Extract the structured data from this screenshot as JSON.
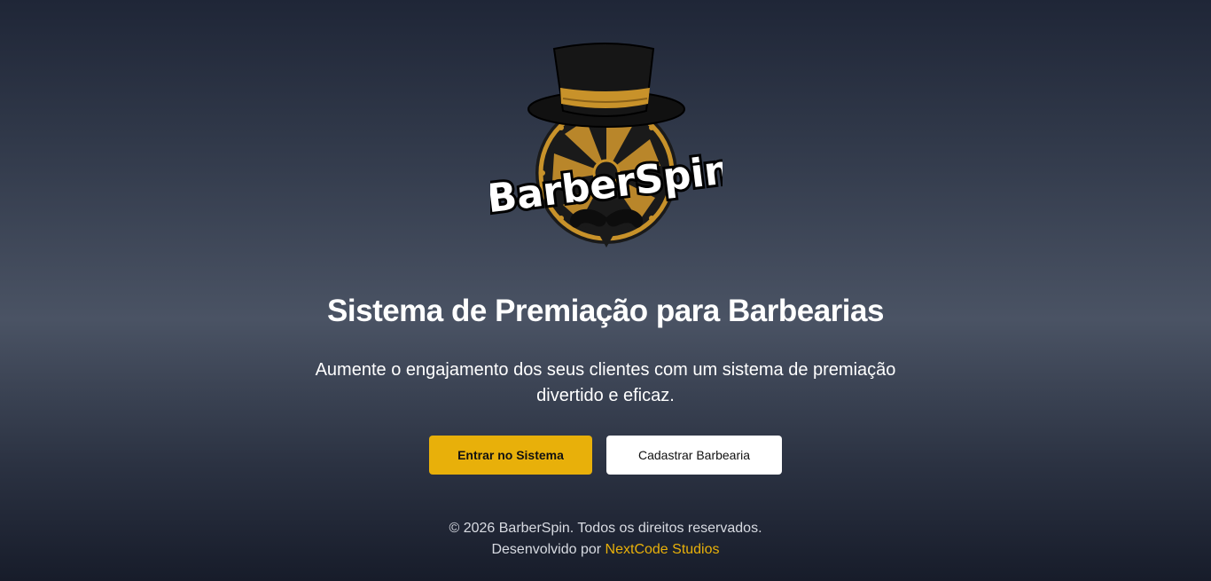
{
  "logo": {
    "text": "BarberSpin",
    "icon": "top-hat-mustache-wheel-logo",
    "colors": {
      "gold": "#c8922a",
      "dark": "#1a1a1a",
      "white": "#ffffff"
    }
  },
  "hero": {
    "title": "Sistema de Premiação para Barbearias",
    "subtitle": "Aumente o engajamento dos seus clientes com um sistema de premiação divertido e eficaz."
  },
  "actions": {
    "login_label": "Entrar no Sistema",
    "register_label": "Cadastrar Barbearia"
  },
  "footer": {
    "copyright": "© 2026 BarberSpin. Todos os direitos reservados.",
    "developed_by": "Desenvolvido por",
    "developer_link": "NextCode Studios"
  },
  "colors": {
    "accent": "#e8b00a",
    "button_secondary_bg": "#ffffff"
  }
}
